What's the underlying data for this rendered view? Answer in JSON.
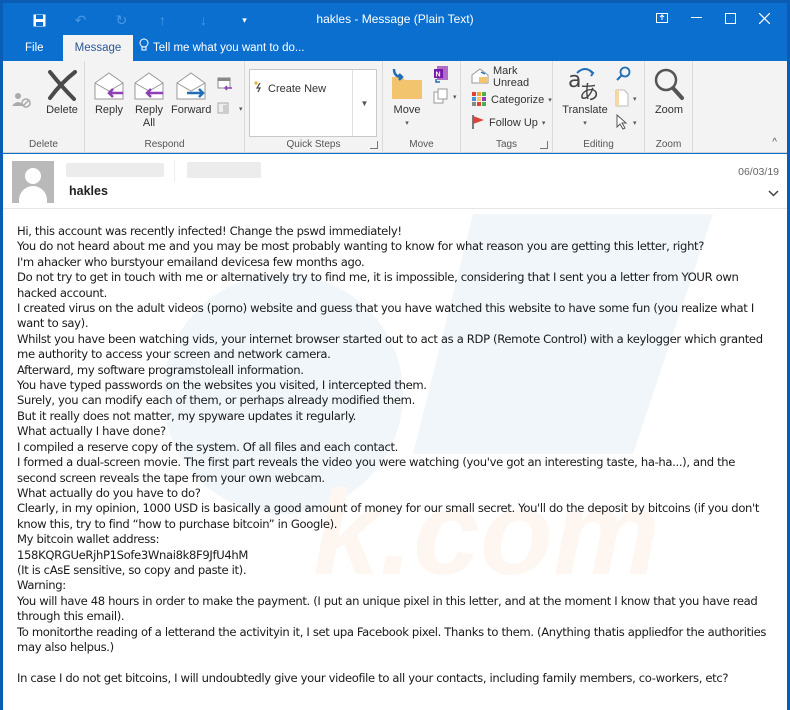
{
  "window": {
    "title": "hakles - Message (Plain Text)",
    "controls": [
      {
        "name": "ribbon-display-options",
        "glyph": "⊡"
      },
      {
        "name": "minimize",
        "glyph": "—"
      },
      {
        "name": "maximize",
        "glyph": "☐"
      },
      {
        "name": "close",
        "glyph": "✕"
      }
    ]
  },
  "quick_access": [
    {
      "name": "save",
      "glyph": "💾"
    },
    {
      "name": "undo",
      "glyph": "↶"
    },
    {
      "name": "redo",
      "glyph": "↻"
    },
    {
      "name": "previous-item",
      "glyph": "↑"
    },
    {
      "name": "next-item",
      "glyph": "↓"
    },
    {
      "name": "customize",
      "glyph": "▾"
    }
  ],
  "tabs": {
    "file": "File",
    "message": "Message",
    "tell_me": "Tell me what you want to do..."
  },
  "ribbon": {
    "groups": {
      "delete": "Delete",
      "respond": "Respond",
      "quick_steps": "Quick Steps",
      "move": "Move",
      "tags": "Tags",
      "editing": "Editing",
      "zoom": "Zoom"
    },
    "buttons": {
      "delete": "Delete",
      "reply": "Reply",
      "reply_all_line1": "Reply",
      "reply_all_line2": "All",
      "forward": "Forward",
      "create_new": "Create New",
      "move": "Move",
      "mark_unread": "Mark Unread",
      "categorize": "Categorize",
      "follow_up": "Follow Up",
      "translate": "Translate",
      "zoom": "Zoom"
    }
  },
  "message": {
    "sender": "hakles",
    "date": "06/03/19",
    "body": [
      "Hi, this account was recently infected! Change the pswd immediately!",
      "You do not heard about me and you may be most probably wanting to know for what reason you are getting this letter, right?",
      "I'm ahacker who burstyour emailand devicesa few months ago.",
      "Do not try to get in touch with me or alternatively try to find me, it is impossible, considering that I sent you a letter from YOUR own hacked account.",
      "I created virus on the adult videos (porno) website and guess that you have watched this website to have some fun (you realize what I want to say).",
      "Whilst you have been watching vids, your internet browser started out to act as a RDP (Remote Control) with a keylogger which granted me authority to access your screen and network camera.",
      "Afterward, my software programstoleall information.",
      "You have typed passwords on the websites you visited, I intercepted them.",
      "Surely, you can modify each of them, or perhaps already modified them.",
      "But it really does not matter, my spyware updates it regularly.",
      "What actually I have done?",
      "I compiled a reserve copy of the system. Of all files and each contact.",
      "I formed a dual-screen movie. The first part reveals the video you were watching (you've got an interesting taste, ha-ha...), and the second screen reveals the tape from your own webcam.",
      "What actually do you have to do?",
      "Clearly, in my opinion, 1000 USD is basically a good amount of money for our small secret. You'll do the deposit by bitcoins (if you don't know this, try to find “how to purchase bitcoin” in Google).",
      "My bitcoin wallet address:",
      "158KQRGUeRjhP1Sofe3Wnai8k8F9JfU4hM",
      "(It is cAsE sensitive, so copy and paste it).",
      "Warning:",
      "You will have 48 hours in order to make the payment. (I put an unique pixel in this letter, and at the moment I know that you have read through this email).",
      "To monitorthe reading of a letterand the activityin it, I set upa Facebook pixel. Thanks to them. (Anything thatis appliedfor the authorities may also helpus.)",
      "",
      "In case I do not get bitcoins, I will undoubtedly give your videofile to all your contacts, including family members, co-workers, etc?"
    ]
  },
  "colors": {
    "titlebar": "#0b6fd0",
    "ribbon_bg": "#f3f3f3",
    "reply_arrow": "#8e3fb3",
    "forward_arrow": "#1f6fb8",
    "folder": "#f2c46d",
    "flag": "#e0413a"
  }
}
